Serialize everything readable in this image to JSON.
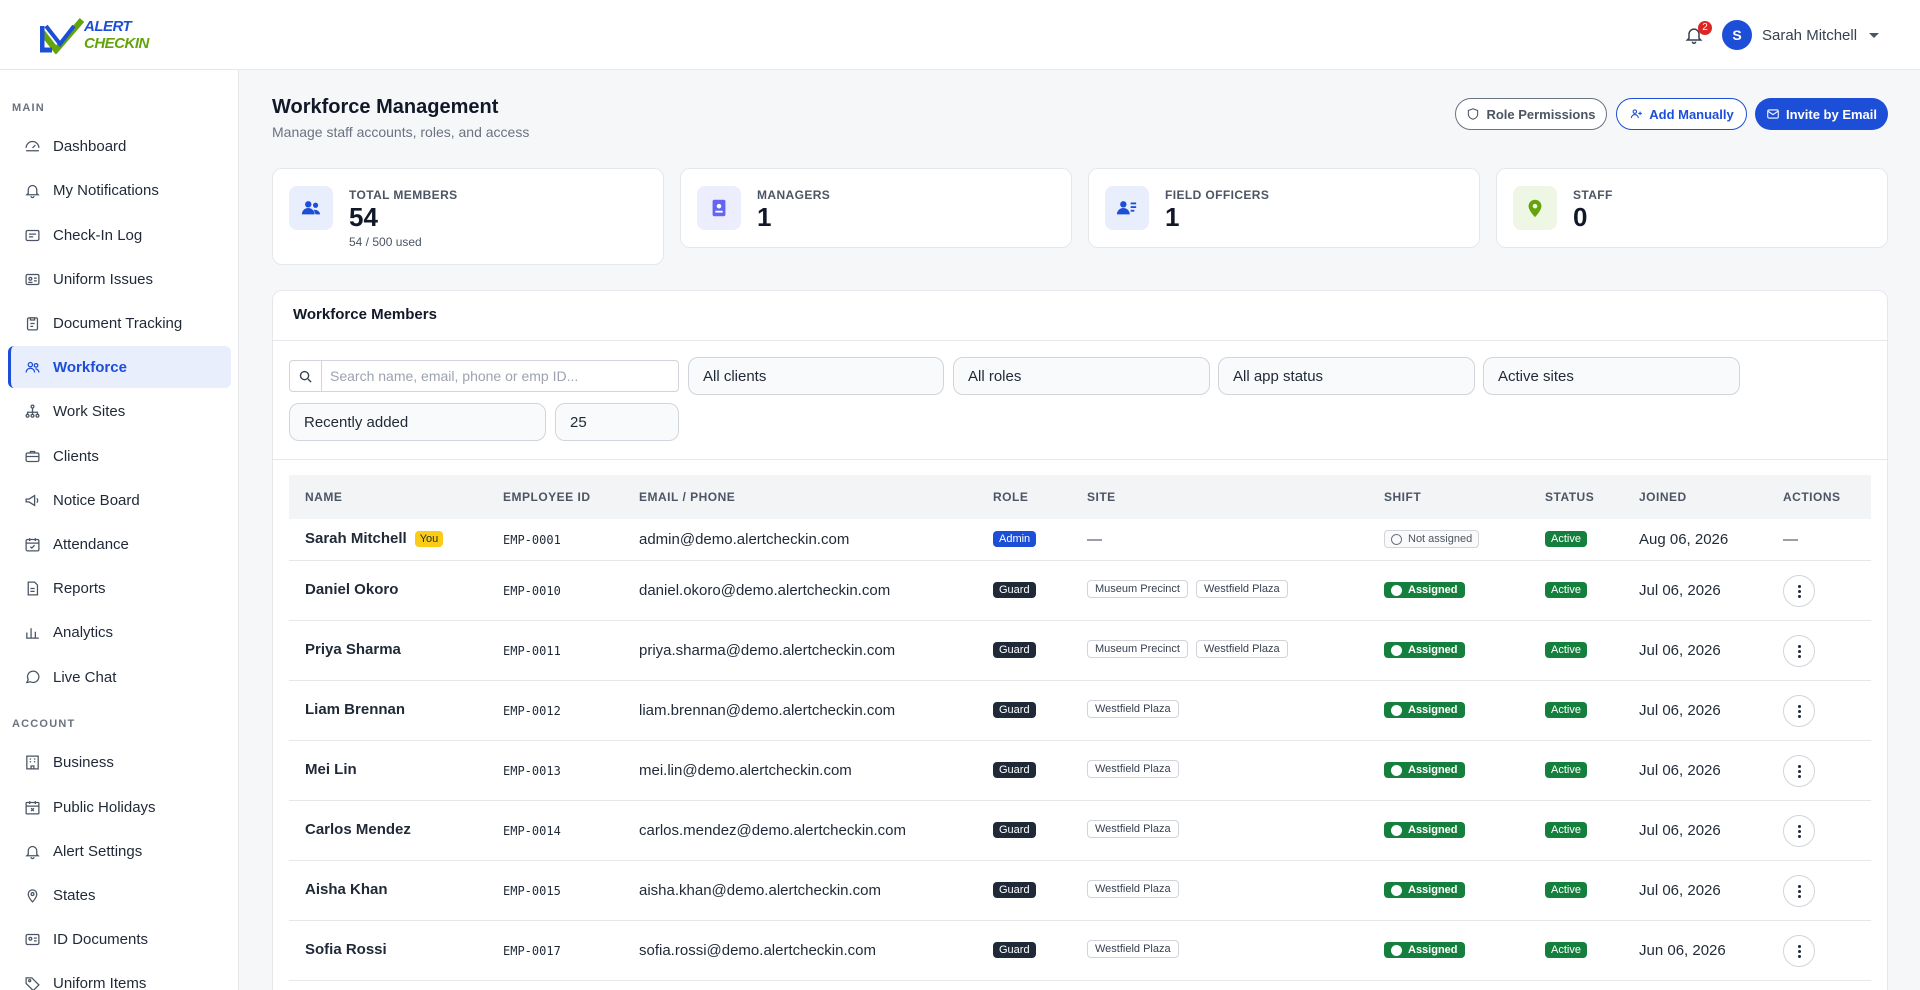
{
  "brand": {
    "line1": "ALERT",
    "line2": "CHECKIN"
  },
  "header": {
    "notification_count": "2",
    "user_initial": "S",
    "user_name": "Sarah Mitchell"
  },
  "sidebar": {
    "main_label": "MAIN",
    "main_items": [
      {
        "label": "Dashboard",
        "icon": "dashboard-icon"
      },
      {
        "label": "My Notifications",
        "icon": "bell-icon"
      },
      {
        "label": "Check-In Log",
        "icon": "log-icon"
      },
      {
        "label": "Uniform Issues",
        "icon": "id-card-icon"
      },
      {
        "label": "Document Tracking",
        "icon": "clipboard-icon"
      },
      {
        "label": "Workforce",
        "icon": "users-icon",
        "active": true
      },
      {
        "label": "Work Sites",
        "icon": "sitemap-icon"
      },
      {
        "label": "Clients",
        "icon": "briefcase-icon"
      },
      {
        "label": "Notice Board",
        "icon": "megaphone-icon"
      },
      {
        "label": "Attendance",
        "icon": "calendar-check-icon"
      },
      {
        "label": "Reports",
        "icon": "file-icon"
      },
      {
        "label": "Analytics",
        "icon": "bar-chart-icon"
      },
      {
        "label": "Live Chat",
        "icon": "chat-icon"
      }
    ],
    "account_label": "ACCOUNT",
    "account_items": [
      {
        "label": "Business",
        "icon": "building-icon"
      },
      {
        "label": "Public Holidays",
        "icon": "calendar-x-icon"
      },
      {
        "label": "Alert Settings",
        "icon": "bell-icon"
      },
      {
        "label": "States",
        "icon": "map-pin-icon"
      },
      {
        "label": "ID Documents",
        "icon": "id-document-icon"
      },
      {
        "label": "Uniform Items",
        "icon": "tag-icon"
      }
    ]
  },
  "page": {
    "title": "Workforce Management",
    "subtitle": "Manage staff accounts, roles, and access",
    "role_permissions_label": "Role Permissions",
    "add_manually_label": "Add Manually",
    "invite_label": "Invite by Email"
  },
  "stats": [
    {
      "label": "TOTAL MEMBERS",
      "value": "54",
      "sub": "54 / 500 used",
      "icon": "users-icon",
      "color": "#1d4ed8",
      "bg": "#e8eefc"
    },
    {
      "label": "MANAGERS",
      "value": "1",
      "sub": "",
      "icon": "badge-icon",
      "color": "#6366f1",
      "bg": "#eceefe"
    },
    {
      "label": "FIELD OFFICERS",
      "value": "1",
      "sub": "",
      "icon": "user-list-icon",
      "color": "#1d4ed8",
      "bg": "#e8eefc"
    },
    {
      "label": "STAFF",
      "value": "0",
      "sub": "",
      "icon": "map-pin-icon",
      "color": "#65a30d",
      "bg": "#eef7e3"
    }
  ],
  "members": {
    "title": "Workforce Members",
    "search_placeholder": "Search name, email, phone or emp ID...",
    "filters": {
      "clients": "All clients",
      "roles": "All roles",
      "app_status": "All app status",
      "sites": "Active sites",
      "sort": "Recently added",
      "page_size": "25"
    },
    "columns": [
      "NAME",
      "EMPLOYEE ID",
      "EMAIL / PHONE",
      "ROLE",
      "SITE",
      "SHIFT",
      "STATUS",
      "JOINED",
      "ACTIONS"
    ],
    "rows": [
      {
        "name": "Sarah Mitchell",
        "you": "You",
        "emp": "EMP-0001",
        "email": "admin@demo.alertcheckin.com",
        "role": "Admin",
        "sites": [],
        "site_empty": "—",
        "shift": "Not assigned",
        "status": "Active",
        "joined": "Aug 06, 2026",
        "action_empty": "—"
      },
      {
        "name": "Daniel Okoro",
        "emp": "EMP-0010",
        "email": "daniel.okoro@demo.alertcheckin.com",
        "role": "Guard",
        "sites": [
          "Museum Precinct",
          "Westfield Plaza"
        ],
        "shift": "Assigned",
        "status": "Active",
        "joined": "Jul 06, 2026"
      },
      {
        "name": "Priya Sharma",
        "emp": "EMP-0011",
        "email": "priya.sharma@demo.alertcheckin.com",
        "role": "Guard",
        "sites": [
          "Museum Precinct",
          "Westfield Plaza"
        ],
        "shift": "Assigned",
        "status": "Active",
        "joined": "Jul 06, 2026"
      },
      {
        "name": "Liam Brennan",
        "emp": "EMP-0012",
        "email": "liam.brennan@demo.alertcheckin.com",
        "role": "Guard",
        "sites": [
          "Westfield Plaza"
        ],
        "shift": "Assigned",
        "status": "Active",
        "joined": "Jul 06, 2026"
      },
      {
        "name": "Mei Lin",
        "emp": "EMP-0013",
        "email": "mei.lin@demo.alertcheckin.com",
        "role": "Guard",
        "sites": [
          "Westfield Plaza"
        ],
        "shift": "Assigned",
        "status": "Active",
        "joined": "Jul 06, 2026"
      },
      {
        "name": "Carlos Mendez",
        "emp": "EMP-0014",
        "email": "carlos.mendez@demo.alertcheckin.com",
        "role": "Guard",
        "sites": [
          "Westfield Plaza"
        ],
        "shift": "Assigned",
        "status": "Active",
        "joined": "Jul 06, 2026"
      },
      {
        "name": "Aisha Khan",
        "emp": "EMP-0015",
        "email": "aisha.khan@demo.alertcheckin.com",
        "role": "Guard",
        "sites": [
          "Westfield Plaza"
        ],
        "shift": "Assigned",
        "status": "Active",
        "joined": "Jul 06, 2026"
      },
      {
        "name": "Sofia Rossi",
        "emp": "EMP-0017",
        "email": "sofia.rossi@demo.alertcheckin.com",
        "role": "Guard",
        "sites": [
          "Westfield Plaza"
        ],
        "shift": "Assigned",
        "status": "Active",
        "joined": "Jun 06, 2026"
      }
    ]
  },
  "colors": {
    "accent": "#1d4ed8",
    "success": "#15803d",
    "admin_role": "#1d4ed8",
    "guard_role": "#1f2937",
    "you_badge": "#facc15"
  }
}
